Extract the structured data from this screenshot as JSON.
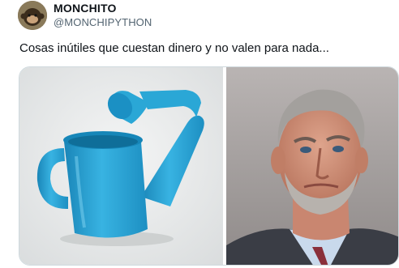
{
  "tweet": {
    "display_name": "MONCHITO",
    "handle": "@MONCHIPYTHON",
    "text": "Cosas inútiles que cuestan dinero y no valen para nada...",
    "media": {
      "left_photo": "watering-can",
      "right_photo": "portrait"
    }
  },
  "colors": {
    "watering_can": "#2aa7d6",
    "handle_gray": "#536471",
    "border": "#cfd9de"
  }
}
